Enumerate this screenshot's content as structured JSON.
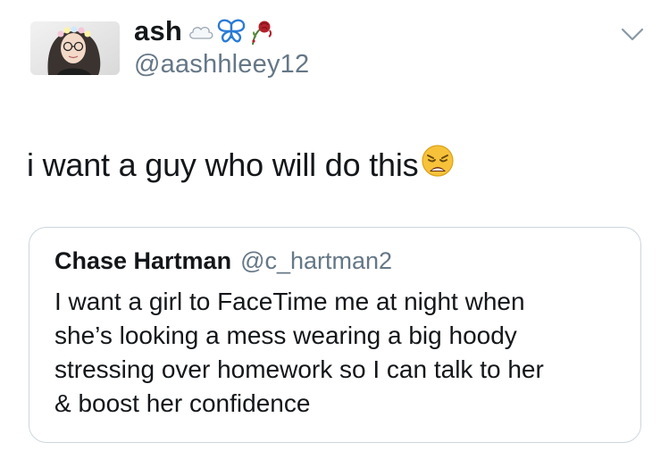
{
  "author": {
    "display_name": "ash",
    "handle": "@aashhleey12",
    "name_emoji_icons": [
      "cloud-icon",
      "butterfly-icon",
      "wilted-rose-icon"
    ]
  },
  "tweet": {
    "text": "i want a guy who will do this",
    "trailing_emoji_icon": "weary-face-icon"
  },
  "quoted_tweet": {
    "display_name": "Chase Hartman",
    "handle": "@c_hartman2",
    "lines": [
      "I want a girl to FaceTime me at night when",
      "she’s looking a mess wearing a big hoody",
      "stressing over homework so I can talk to her",
      "& boost her confidence"
    ]
  },
  "colors": {
    "text_primary": "#14171a",
    "text_secondary": "#657786",
    "card_border": "#ccd6dd",
    "butterfly_blue": "#2a7bd6",
    "rose_red": "#b3202a"
  }
}
